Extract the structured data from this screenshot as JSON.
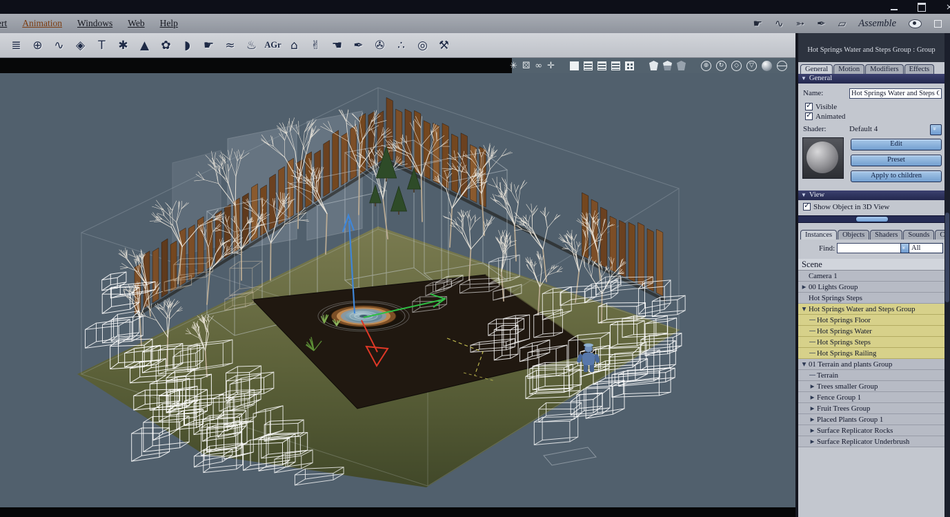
{
  "accent_color": "#6f9bd0",
  "selection_color": "#d7d18a",
  "viewport_bg": "#51606d",
  "window": {
    "controls": [
      {
        "name": "minimize-button"
      },
      {
        "name": "maximize-button"
      },
      {
        "name": "close-button"
      }
    ]
  },
  "menubar": {
    "items": [
      {
        "label": "ert"
      },
      {
        "label": "Animation",
        "active": true
      },
      {
        "label": "Windows"
      },
      {
        "label": "Web"
      },
      {
        "label": "Help"
      }
    ],
    "right_icons": [
      {
        "name": "pan-hand-icon",
        "glyph": "☛"
      },
      {
        "name": "lasso-icon",
        "glyph": "∿"
      },
      {
        "name": "arrow-tool-icon",
        "glyph": "➳"
      },
      {
        "name": "dropper-icon",
        "glyph": "✒"
      },
      {
        "name": "plane-tool-icon",
        "glyph": "▱"
      }
    ],
    "mode_label": "Assemble"
  },
  "toolbar": {
    "icons": [
      {
        "name": "vertex-object-icon",
        "glyph": "≣"
      },
      {
        "name": "sphere-primitive-icon",
        "glyph": "⊕"
      },
      {
        "name": "spline-object-icon",
        "glyph": "∿"
      },
      {
        "name": "torus-icon",
        "glyph": "◈"
      },
      {
        "name": "text-primitive-icon",
        "glyph": "T"
      },
      {
        "name": "particle-emitter-icon",
        "glyph": "✱"
      },
      {
        "name": "terrain-icon",
        "glyph": "▲"
      },
      {
        "name": "plant-icon",
        "glyph": "✿"
      },
      {
        "name": "metaball-icon",
        "glyph": "◗"
      },
      {
        "name": "finger-tool-icon",
        "glyph": "☛"
      },
      {
        "name": "ocean-icon",
        "glyph": "≈"
      },
      {
        "name": "volcano-icon",
        "glyph": "♨"
      },
      {
        "name": "agr-icon",
        "text": "AGr"
      },
      {
        "name": "architecture-icon",
        "glyph": "⌂"
      },
      {
        "name": "glove-icon",
        "glyph": "✌"
      },
      {
        "name": "hand-icon",
        "glyph": "☚"
      },
      {
        "name": "needle-icon",
        "glyph": "✒"
      },
      {
        "name": "movie-camera-icon",
        "glyph": "✇"
      },
      {
        "name": "replicator-icon",
        "glyph": "∴"
      },
      {
        "name": "target-icon",
        "glyph": "◎"
      },
      {
        "name": "wrench-icon",
        "glyph": "⚒"
      }
    ]
  },
  "viewport_toolbar": {
    "icons": [
      {
        "name": "atom-preview-icon",
        "kind": "glyph",
        "glyph": "✳"
      },
      {
        "name": "scene-dice-icon",
        "kind": "glyph",
        "glyph": "⚄"
      },
      {
        "name": "aerial-view-icon",
        "kind": "glyph",
        "glyph": "∞"
      },
      {
        "name": "move-cross-icon",
        "kind": "glyph",
        "glyph": "✛"
      },
      {
        "name": "gap1",
        "kind": "gap"
      },
      {
        "name": "display-solid-icon",
        "kind": "sq",
        "variant": "solid"
      },
      {
        "name": "display-gouraud-icon",
        "kind": "sq",
        "variant": "lines"
      },
      {
        "name": "display-flat-icon",
        "kind": "sq",
        "variant": "lines"
      },
      {
        "name": "display-lines-icon",
        "kind": "sq",
        "variant": "lines"
      },
      {
        "name": "display-grid-icon",
        "kind": "sq",
        "variant": "grid"
      },
      {
        "name": "gap2",
        "kind": "gap"
      },
      {
        "name": "shield-full-icon",
        "kind": "shield",
        "variant": "s1"
      },
      {
        "name": "shield-half-icon",
        "kind": "shield",
        "variant": "s2"
      },
      {
        "name": "shield-wire-icon",
        "kind": "shield",
        "variant": "s3"
      },
      {
        "name": "gap3",
        "kind": "gap"
      },
      {
        "name": "add-view-icon",
        "kind": "circ",
        "glyph": "⊕"
      },
      {
        "name": "rotate-view-icon",
        "kind": "circ",
        "glyph": "↻"
      },
      {
        "name": "diamond-view-icon",
        "kind": "circ",
        "glyph": "◇"
      },
      {
        "name": "plane-view-icon",
        "kind": "circ",
        "glyph": "▽"
      },
      {
        "name": "shaded-ball-icon",
        "kind": "ball",
        "variant": "solid"
      },
      {
        "name": "wire-ball-icon",
        "kind": "ball",
        "variant": "wire"
      }
    ]
  },
  "panel": {
    "title": "Hot Springs Water and Steps Group : Group",
    "tabs": [
      {
        "label": "General",
        "active": true
      },
      {
        "label": "Motion"
      },
      {
        "label": "Modifiers"
      },
      {
        "label": "Effects"
      }
    ],
    "general": {
      "section_label": "General",
      "name_label": "Name:",
      "name_value": "Hot Springs Water and Steps Grou",
      "visible_label": "Visible",
      "visible_checked": true,
      "animated_label": "Animated",
      "animated_checked": true,
      "shader_label": "Shader:",
      "shader_value": "Default 4",
      "buttons": [
        {
          "name": "edit-button",
          "label": "Edit"
        },
        {
          "name": "preset-button",
          "label": "Preset"
        },
        {
          "name": "apply-to-children-button",
          "label": "Apply to children"
        }
      ]
    },
    "view": {
      "section_label": "View",
      "show_object_label": "Show Object in 3D View",
      "show_object_checked": true
    },
    "browser": {
      "tabs": [
        {
          "label": "Instances",
          "active": true
        },
        {
          "label": "Objects"
        },
        {
          "label": "Shaders"
        },
        {
          "label": "Sounds"
        },
        {
          "label": "Clips"
        }
      ],
      "find_label": "Find:",
      "find_value": "",
      "filter_value": "All",
      "scene_label": "Scene",
      "tree": [
        {
          "label": "Camera 1",
          "level": 1,
          "arrow": "none",
          "selected": false
        },
        {
          "label": "00 Lights Group",
          "level": 1,
          "arrow": "collapsed",
          "selected": false
        },
        {
          "label": "Hot Springs Steps",
          "level": 1,
          "arrow": "none",
          "selected": false
        },
        {
          "label": "Hot Springs Water and Steps Group",
          "level": 1,
          "arrow": "expanded",
          "selected": true
        },
        {
          "label": "Hot Springs Floor",
          "level": 2,
          "arrow": "leaf",
          "selected": true
        },
        {
          "label": "Hot Springs Water",
          "level": 2,
          "arrow": "leaf",
          "selected": true
        },
        {
          "label": "Hot Springs Steps",
          "level": 2,
          "arrow": "leaf",
          "selected": true
        },
        {
          "label": "Hot Springs Railing",
          "level": 2,
          "arrow": "leaf",
          "selected": true
        },
        {
          "label": "01 Terrain and plants Group",
          "level": 1,
          "arrow": "expanded",
          "selected": false
        },
        {
          "label": "Terrain",
          "level": 2,
          "arrow": "leaf",
          "selected": false
        },
        {
          "label": "Trees smaller Group",
          "level": 2,
          "arrow": "collapsed",
          "selected": false
        },
        {
          "label": "Fence Group 1",
          "level": 2,
          "arrow": "collapsed",
          "selected": false
        },
        {
          "label": "Fruit Trees Group",
          "level": 2,
          "arrow": "collapsed",
          "selected": false
        },
        {
          "label": "Placed Plants Group 1",
          "level": 2,
          "arrow": "collapsed",
          "selected": false
        },
        {
          "label": "Surface Replicator Rocks",
          "level": 2,
          "arrow": "collapsed",
          "selected": false
        },
        {
          "label": "Surface Replicator Underbrush",
          "level": 2,
          "arrow": "collapsed",
          "selected": false
        }
      ]
    }
  }
}
